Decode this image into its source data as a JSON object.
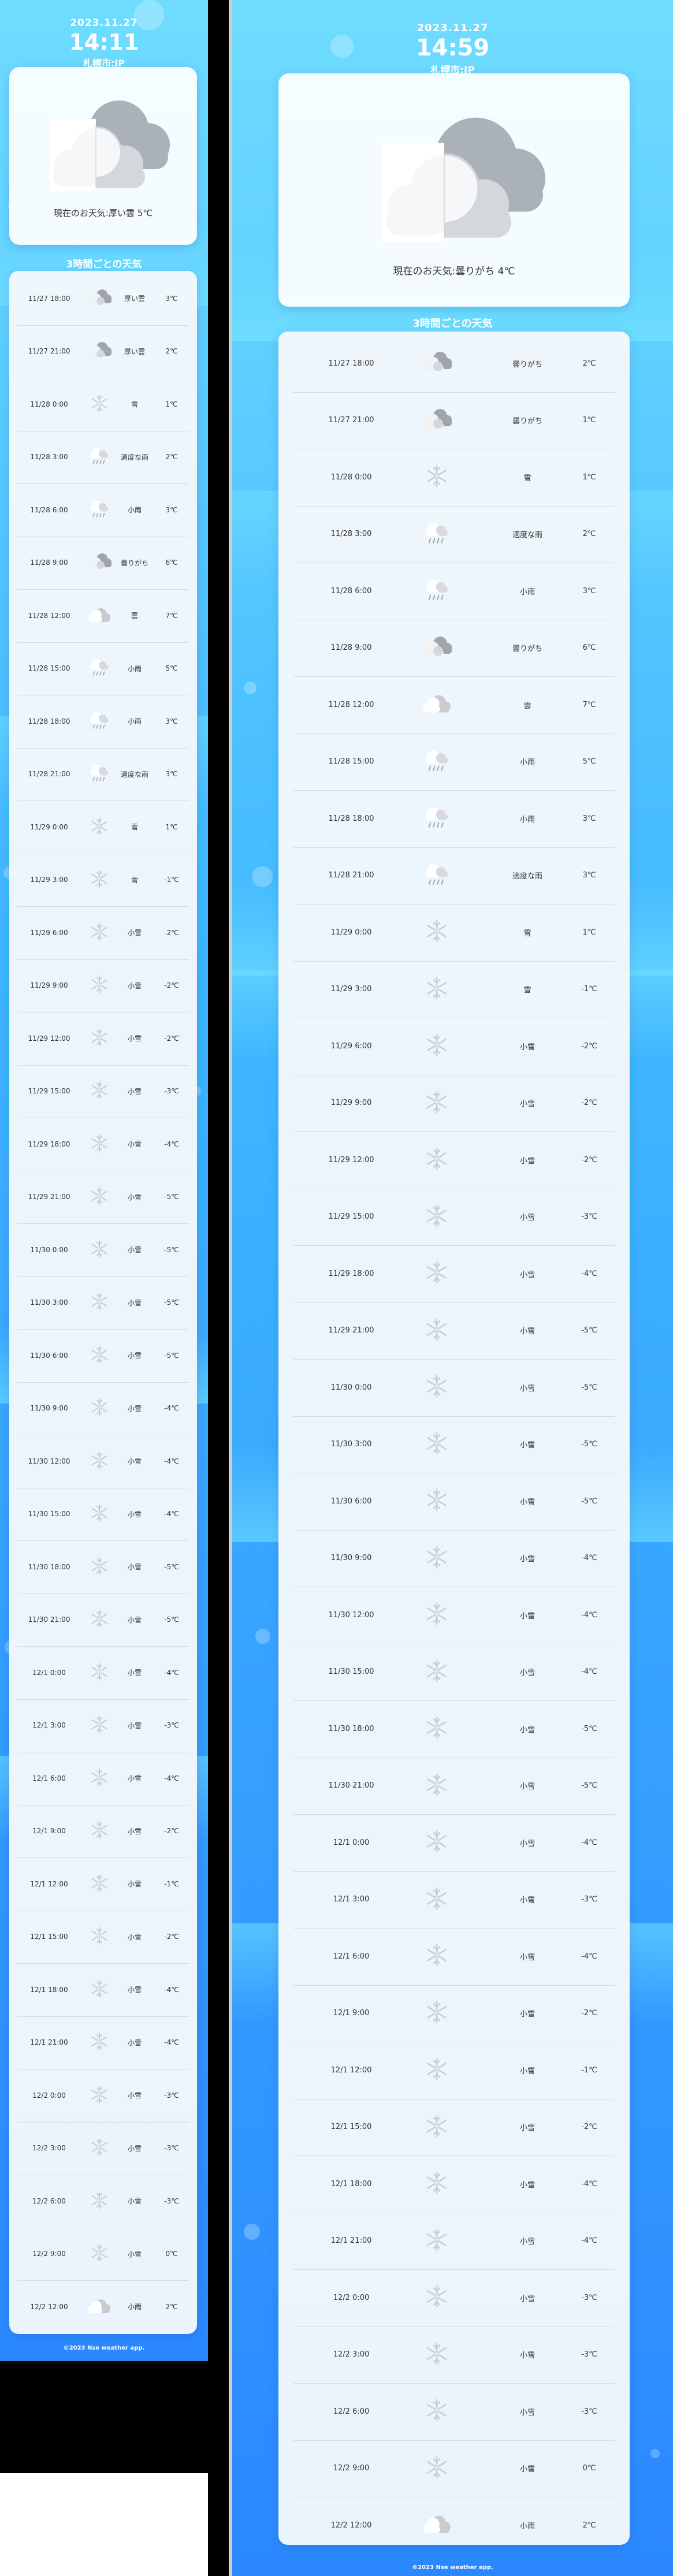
{
  "header": {
    "date": "2023.11.27",
    "location": "札幌市:JP"
  },
  "screens": [
    {
      "time": "14:11",
      "current": "現在のお天気:厚い雲 5℃"
    },
    {
      "time": "14:59",
      "current": "現在のお天気:曇りがち 4℃"
    }
  ],
  "section_title": "3時間ごとの天気",
  "footer": "©2023 Nse weather app.",
  "icon_names": [
    "cloud-icon",
    "dark-cloud-icon",
    "snow-icon",
    "rain-icon"
  ],
  "forecast_a": [
    {
      "dt": "11/27 18:00",
      "icon": "dark-cloud",
      "desc": "厚い雲",
      "temp": "3℃"
    },
    {
      "dt": "11/27 21:00",
      "icon": "dark-cloud",
      "desc": "厚い雲",
      "temp": "2℃"
    },
    {
      "dt": "11/28 0:00",
      "icon": "snow",
      "desc": "雪",
      "temp": "1℃"
    },
    {
      "dt": "11/28 3:00",
      "icon": "rain",
      "desc": "適度な雨",
      "temp": "2℃"
    },
    {
      "dt": "11/28 6:00",
      "icon": "rain",
      "desc": "小雨",
      "temp": "3℃"
    },
    {
      "dt": "11/28 9:00",
      "icon": "dark-cloud",
      "desc": "曇りがち",
      "temp": "6℃"
    },
    {
      "dt": "11/28 12:00",
      "icon": "cloud",
      "desc": "雲",
      "temp": "7℃"
    },
    {
      "dt": "11/28 15:00",
      "icon": "rain",
      "desc": "小雨",
      "temp": "5℃"
    },
    {
      "dt": "11/28 18:00",
      "icon": "rain",
      "desc": "小雨",
      "temp": "3℃"
    },
    {
      "dt": "11/28 21:00",
      "icon": "rain",
      "desc": "適度な雨",
      "temp": "3℃"
    },
    {
      "dt": "11/29 0:00",
      "icon": "snow",
      "desc": "雪",
      "temp": "1℃"
    },
    {
      "dt": "11/29 3:00",
      "icon": "snow",
      "desc": "雪",
      "temp": "-1℃"
    },
    {
      "dt": "11/29 6:00",
      "icon": "snow",
      "desc": "小雪",
      "temp": "-2℃"
    },
    {
      "dt": "11/29 9:00",
      "icon": "snow",
      "desc": "小雪",
      "temp": "-2℃"
    },
    {
      "dt": "11/29 12:00",
      "icon": "snow",
      "desc": "小雪",
      "temp": "-2℃"
    },
    {
      "dt": "11/29 15:00",
      "icon": "snow",
      "desc": "小雪",
      "temp": "-3℃"
    },
    {
      "dt": "11/29 18:00",
      "icon": "snow",
      "desc": "小雪",
      "temp": "-4℃"
    },
    {
      "dt": "11/29 21:00",
      "icon": "snow",
      "desc": "小雪",
      "temp": "-5℃"
    },
    {
      "dt": "11/30 0:00",
      "icon": "snow",
      "desc": "小雪",
      "temp": "-5℃"
    },
    {
      "dt": "11/30 3:00",
      "icon": "snow",
      "desc": "小雪",
      "temp": "-5℃"
    },
    {
      "dt": "11/30 6:00",
      "icon": "snow",
      "desc": "小雪",
      "temp": "-5℃"
    },
    {
      "dt": "11/30 9:00",
      "icon": "snow",
      "desc": "小雪",
      "temp": "-4℃"
    },
    {
      "dt": "11/30 12:00",
      "icon": "snow",
      "desc": "小雪",
      "temp": "-4℃"
    },
    {
      "dt": "11/30 15:00",
      "icon": "snow",
      "desc": "小雪",
      "temp": "-4℃"
    },
    {
      "dt": "11/30 18:00",
      "icon": "snow",
      "desc": "小雪",
      "temp": "-5℃"
    },
    {
      "dt": "11/30 21:00",
      "icon": "snow",
      "desc": "小雪",
      "temp": "-5℃"
    },
    {
      "dt": "12/1 0:00",
      "icon": "snow",
      "desc": "小雪",
      "temp": "-4℃"
    },
    {
      "dt": "12/1 3:00",
      "icon": "snow",
      "desc": "小雪",
      "temp": "-3℃"
    },
    {
      "dt": "12/1 6:00",
      "icon": "snow",
      "desc": "小雪",
      "temp": "-4℃"
    },
    {
      "dt": "12/1 9:00",
      "icon": "snow",
      "desc": "小雪",
      "temp": "-2℃"
    },
    {
      "dt": "12/1 12:00",
      "icon": "snow",
      "desc": "小雪",
      "temp": "-1℃"
    },
    {
      "dt": "12/1 15:00",
      "icon": "snow",
      "desc": "小雪",
      "temp": "-2℃"
    },
    {
      "dt": "12/1 18:00",
      "icon": "snow",
      "desc": "小雪",
      "temp": "-4℃"
    },
    {
      "dt": "12/1 21:00",
      "icon": "snow",
      "desc": "小雪",
      "temp": "-4℃"
    },
    {
      "dt": "12/2 0:00",
      "icon": "snow",
      "desc": "小雪",
      "temp": "-3℃"
    },
    {
      "dt": "12/2 3:00",
      "icon": "snow",
      "desc": "小雪",
      "temp": "-3℃"
    },
    {
      "dt": "12/2 6:00",
      "icon": "snow",
      "desc": "小雪",
      "temp": "-3℃"
    },
    {
      "dt": "12/2 9:00",
      "icon": "snow",
      "desc": "小雪",
      "temp": "0℃"
    },
    {
      "dt": "12/2 12:00",
      "icon": "cloud",
      "desc": "小雨",
      "temp": "2℃"
    }
  ],
  "forecast_b": [
    {
      "dt": "11/27 18:00",
      "icon": "dark-cloud",
      "desc": "曇りがち",
      "temp": "2℃"
    },
    {
      "dt": "11/27 21:00",
      "icon": "dark-cloud",
      "desc": "曇りがち",
      "temp": "1℃"
    },
    {
      "dt": "11/28 0:00",
      "icon": "snow",
      "desc": "雪",
      "temp": "1℃"
    },
    {
      "dt": "11/28 3:00",
      "icon": "rain",
      "desc": "適度な雨",
      "temp": "2℃"
    },
    {
      "dt": "11/28 6:00",
      "icon": "rain",
      "desc": "小雨",
      "temp": "3℃"
    },
    {
      "dt": "11/28 9:00",
      "icon": "dark-cloud",
      "desc": "曇りがち",
      "temp": "6℃"
    },
    {
      "dt": "11/28 12:00",
      "icon": "cloud",
      "desc": "雲",
      "temp": "7℃"
    },
    {
      "dt": "11/28 15:00",
      "icon": "rain",
      "desc": "小雨",
      "temp": "5℃"
    },
    {
      "dt": "11/28 18:00",
      "icon": "rain",
      "desc": "小雨",
      "temp": "3℃"
    },
    {
      "dt": "11/28 21:00",
      "icon": "rain",
      "desc": "適度な雨",
      "temp": "3℃"
    },
    {
      "dt": "11/29 0:00",
      "icon": "snow",
      "desc": "雪",
      "temp": "1℃"
    },
    {
      "dt": "11/29 3:00",
      "icon": "snow",
      "desc": "雪",
      "temp": "-1℃"
    },
    {
      "dt": "11/29 6:00",
      "icon": "snow",
      "desc": "小雪",
      "temp": "-2℃"
    },
    {
      "dt": "11/29 9:00",
      "icon": "snow",
      "desc": "小雪",
      "temp": "-2℃"
    },
    {
      "dt": "11/29 12:00",
      "icon": "snow",
      "desc": "小雪",
      "temp": "-2℃"
    },
    {
      "dt": "11/29 15:00",
      "icon": "snow",
      "desc": "小雪",
      "temp": "-3℃"
    },
    {
      "dt": "11/29 18:00",
      "icon": "snow",
      "desc": "小雪",
      "temp": "-4℃"
    },
    {
      "dt": "11/29 21:00",
      "icon": "snow",
      "desc": "小雪",
      "temp": "-5℃"
    },
    {
      "dt": "11/30 0:00",
      "icon": "snow",
      "desc": "小雪",
      "temp": "-5℃"
    },
    {
      "dt": "11/30 3:00",
      "icon": "snow",
      "desc": "小雪",
      "temp": "-5℃"
    },
    {
      "dt": "11/30 6:00",
      "icon": "snow",
      "desc": "小雪",
      "temp": "-5℃"
    },
    {
      "dt": "11/30 9:00",
      "icon": "snow",
      "desc": "小雪",
      "temp": "-4℃"
    },
    {
      "dt": "11/30 12:00",
      "icon": "snow",
      "desc": "小雪",
      "temp": "-4℃"
    },
    {
      "dt": "11/30 15:00",
      "icon": "snow",
      "desc": "小雪",
      "temp": "-4℃"
    },
    {
      "dt": "11/30 18:00",
      "icon": "snow",
      "desc": "小雪",
      "temp": "-5℃"
    },
    {
      "dt": "11/30 21:00",
      "icon": "snow",
      "desc": "小雪",
      "temp": "-5℃"
    },
    {
      "dt": "12/1 0:00",
      "icon": "snow",
      "desc": "小雪",
      "temp": "-4℃"
    },
    {
      "dt": "12/1 3:00",
      "icon": "snow",
      "desc": "小雪",
      "temp": "-3℃"
    },
    {
      "dt": "12/1 6:00",
      "icon": "snow",
      "desc": "小雪",
      "temp": "-4℃"
    },
    {
      "dt": "12/1 9:00",
      "icon": "snow",
      "desc": "小雪",
      "temp": "-2℃"
    },
    {
      "dt": "12/1 12:00",
      "icon": "snow",
      "desc": "小雪",
      "temp": "-1℃"
    },
    {
      "dt": "12/1 15:00",
      "icon": "snow",
      "desc": "小雪",
      "temp": "-2℃"
    },
    {
      "dt": "12/1 18:00",
      "icon": "snow",
      "desc": "小雪",
      "temp": "-4℃"
    },
    {
      "dt": "12/1 21:00",
      "icon": "snow",
      "desc": "小雪",
      "temp": "-4℃"
    },
    {
      "dt": "12/2 0:00",
      "icon": "snow",
      "desc": "小雪",
      "temp": "-3℃"
    },
    {
      "dt": "12/2 3:00",
      "icon": "snow",
      "desc": "小雪",
      "temp": "-3℃"
    },
    {
      "dt": "12/2 6:00",
      "icon": "snow",
      "desc": "小雪",
      "temp": "-3℃"
    },
    {
      "dt": "12/2 9:00",
      "icon": "snow",
      "desc": "小雪",
      "temp": "0℃"
    },
    {
      "dt": "12/2 12:00",
      "icon": "cloud",
      "desc": "小雨",
      "temp": "2℃"
    }
  ],
  "colors": {
    "bg_top": "#6fdcff",
    "bg_mid": "#3fb6ff",
    "bg_bottom": "#2b88ff",
    "card": "#f4f8fc",
    "text": "#333333",
    "divider": "#d4dbe4"
  }
}
